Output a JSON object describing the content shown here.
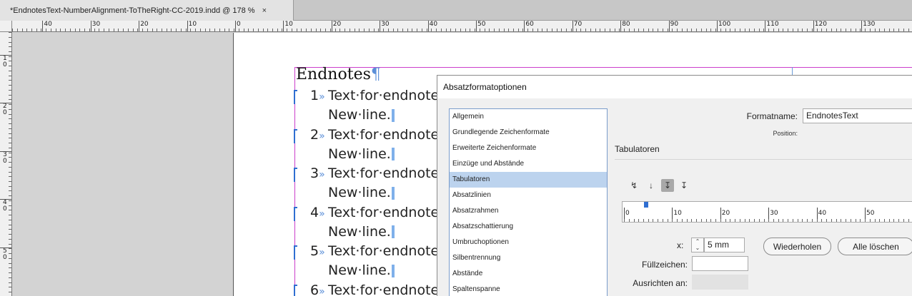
{
  "tab": {
    "title": "*EndnotesText-NumberAlignment-ToTheRight-CC-2019.indd @ 178 %",
    "close": "×"
  },
  "hruler": {
    "labels": [
      "40",
      "30",
      "20",
      "10",
      "0",
      "10",
      "20",
      "30",
      "40",
      "50",
      "60",
      "70",
      "80",
      "90",
      "100",
      "110",
      "120",
      "130"
    ]
  },
  "vruler": {
    "labels": [
      "1\n0",
      "2\n0",
      "3\n0",
      "4\n0",
      "5\n0"
    ]
  },
  "document": {
    "heading": "Endnotes",
    "pilcrow": "¶",
    "arrow": "»",
    "entries": [
      {
        "number": "1",
        "text": "Text·for·endnote",
        "second": "New·line."
      },
      {
        "number": "2",
        "text": "Text·for·endnote",
        "second": "New·line."
      },
      {
        "number": "3",
        "text": "Text·for·endnote",
        "second": "New·line."
      },
      {
        "number": "4",
        "text": "Text·for·endnote",
        "second": "New·line."
      },
      {
        "number": "5",
        "text": "Text·for·endnote",
        "second": "New·line."
      },
      {
        "number": "6",
        "text": "Text·for·endnote"
      }
    ]
  },
  "dialog": {
    "title": "Absatzformatoptionen",
    "categories": [
      "Allgemein",
      "Grundlegende Zeichenformate",
      "Erweiterte Zeichenformate",
      "Einzüge und Abstände",
      "Tabulatoren",
      "Absatzlinien",
      "Absatzrahmen",
      "Absatzschattierung",
      "Umbruchoptionen",
      "Silbentrennung",
      "Abstände",
      "Spaltenspanne"
    ],
    "selected_category": "Tabulatoren",
    "format_name_label": "Formatname:",
    "format_name_value": "EndnotesText",
    "position_label": "Position:",
    "section_title": "Tabulatoren",
    "tab_ruler_labels": [
      "0",
      "10",
      "20",
      "30",
      "40",
      "50"
    ],
    "x_label": "x:",
    "x_value": "5 mm",
    "repeat_button": "Wiederholen",
    "clear_all_button": "Alle löschen",
    "fill_label": "Füllzeichen:",
    "align_label": "Ausrichten an:",
    "tab_icons": [
      "left-tab-icon",
      "center-tab-icon",
      "right-tab-icon",
      "decimal-tab-icon"
    ]
  },
  "colors": {
    "accent": "#2f6ed1",
    "margin": "#cc3fcc",
    "selection": "#bcd3ee"
  }
}
